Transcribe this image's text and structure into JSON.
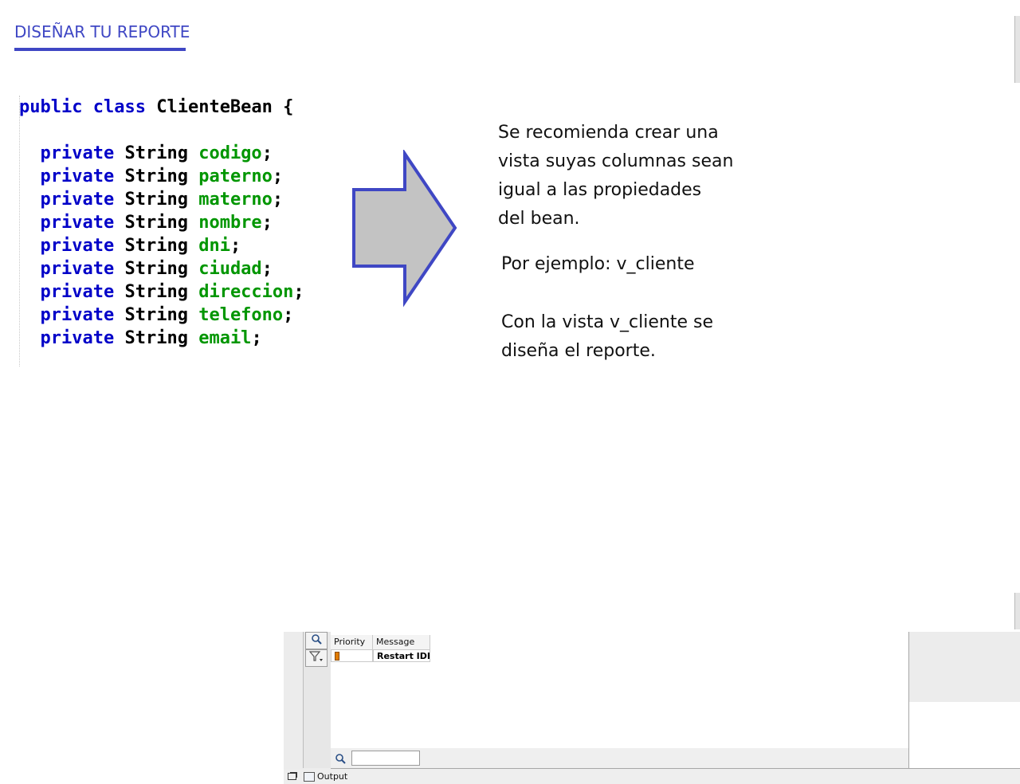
{
  "header": {
    "title": "DISEÑAR TU REPORTE"
  },
  "code": {
    "class_decl": {
      "kw1": "public",
      "kw2": "class",
      "name": "ClienteBean",
      "brace": "{"
    },
    "fields": [
      {
        "modifier": "private",
        "type": "String",
        "name": "codigo"
      },
      {
        "modifier": "private",
        "type": "String",
        "name": "paterno"
      },
      {
        "modifier": "private",
        "type": "String",
        "name": "materno"
      },
      {
        "modifier": "private",
        "type": "String",
        "name": "nombre"
      },
      {
        "modifier": "private",
        "type": "String",
        "name": "dni"
      },
      {
        "modifier": "private",
        "type": "String",
        "name": "ciudad"
      },
      {
        "modifier": "private",
        "type": "String",
        "name": "direccion"
      },
      {
        "modifier": "private",
        "type": "String",
        "name": "telefono"
      },
      {
        "modifier": "private",
        "type": "String",
        "name": "email"
      }
    ],
    "semicolon": ";"
  },
  "notes": {
    "recommend": [
      "Se recomienda crear una",
      "vista suyas columnas sean",
      "igual a las propiedades",
      "del bean."
    ],
    "example": "Por ejemplo: v_cliente",
    "design": [
      "Con la vista v_cliente se",
      "diseña el reporte."
    ]
  },
  "ide": {
    "columns": {
      "priority": "Priority",
      "message": "Message"
    },
    "row": {
      "message": "Restart IDE t"
    },
    "status_tab": "Output",
    "icons": {
      "search": "search-icon",
      "filter": "filter-icon",
      "output": "output-icon",
      "restore": "restore-window-icon"
    }
  },
  "colors": {
    "accent": "#3f47c4",
    "keyword": "#0000c8",
    "field": "#009600",
    "arrow_fill": "#c3c3c3",
    "arrow_stroke": "#3f47c4"
  }
}
